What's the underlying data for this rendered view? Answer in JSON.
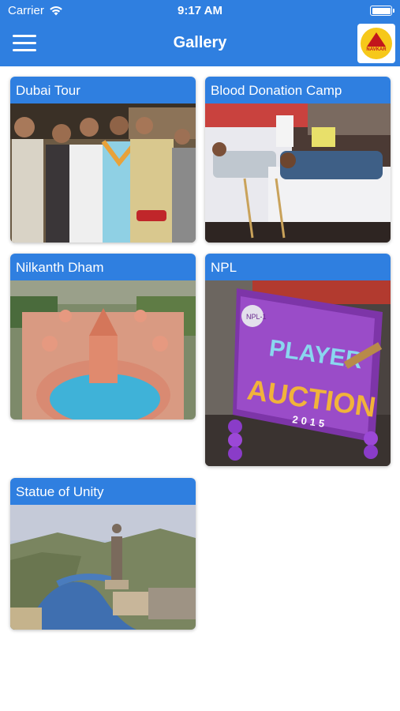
{
  "status_bar": {
    "carrier": "Carrier",
    "time": "9:17 AM"
  },
  "nav": {
    "title": "Gallery",
    "logo_text": "NAVKAR"
  },
  "gallery": [
    {
      "title": "Dubai Tour"
    },
    {
      "title": "Blood Donation Camp"
    },
    {
      "title": "Nilkanth Dham"
    },
    {
      "title": "NPL",
      "image_text": {
        "badge": "NPL-1",
        "line1": "PLAYER",
        "line2": "AUCTION",
        "year": "2015"
      }
    },
    {
      "title": "Statue of Unity"
    }
  ],
  "colors": {
    "primary": "#2f7fe0",
    "background": "#ffffff"
  }
}
